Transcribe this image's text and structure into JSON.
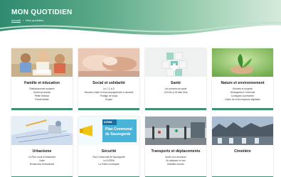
{
  "header": {
    "title": "MON QUOTIDIEN",
    "breadcrumb": {
      "home": "Accueil",
      "separator": "›",
      "current": "Mon quotidien"
    }
  },
  "cards": [
    {
      "title": "Famille et éducation",
      "links": [
        "Établissements scolaires",
        "Service jeunesse",
        "Petite enfance",
        "Portail famille"
      ]
    },
    {
      "title": "Social et solidarité",
      "links": [
        "Le C.C.A.S",
        "Services d'aide et d'accompagnement à domicile",
        "Portage de repas",
        "Emploi"
      ]
    },
    {
      "title": "Santé",
      "links": [
        "Les services de santé",
        "LEXVILLA ID Alès Oise"
      ]
    },
    {
      "title": "Nature et environnement",
      "links": [
        "Déchets et propreté",
        "Déneigement / hivernale",
        "Consignes à présenter",
        "Cadre vie et les espaces végétales"
      ]
    },
    {
      "title": "Urbanisme",
      "links": [
        "Le Plan Local d'Urbanisme",
        "Voirie",
        "Démarches d'urbanisme"
      ]
    },
    {
      "title": "Sécurité",
      "links": [
        "Plan Communal de Sauvegarde",
        "Le DICRIM",
        "La Police municipale"
      ],
      "image_text": [
        "ICRIM",
        "Plan Communal",
        "de Sauvegarde"
      ]
    },
    {
      "title": "Transports et déplacements",
      "links": [
        "Accès à la commune",
        "Se déplacer en bus",
        "Mobilités douces"
      ]
    },
    {
      "title": "Cimetière",
      "links": []
    }
  ],
  "colors": {
    "accent": "#3f8f78",
    "header_dark": "#2f8a6f",
    "header_light": "#d6eadc"
  }
}
